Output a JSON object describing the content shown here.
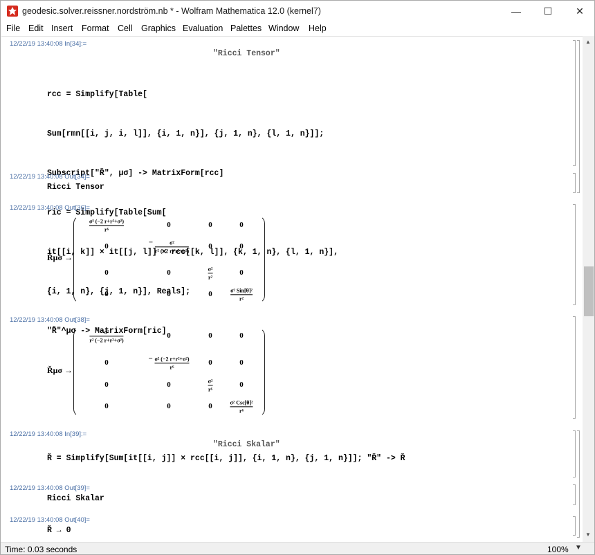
{
  "window": {
    "title": "geodesic.solver.reissner.nordström.nb * - Wolfram Mathematica 12.0 (kernel7)",
    "minimize": "—",
    "maximize": "☐",
    "close": "✕"
  },
  "menu": [
    "File",
    "Edit",
    "Insert",
    "Format",
    "Cell",
    "Graphics",
    "Evaluation",
    "Palettes",
    "Window",
    "Help"
  ],
  "cells": {
    "in34": {
      "stamp": "12/22/19 13:40:08 In[34]:=",
      "title": "\"Ricci Tensor\"",
      "lines": [
        "rcc = Simplify[Table[",
        "Sum[rmn[[i, j, i, l]], {i, 1, n}], {j, 1, n}, {l, 1, n}]];",
        "Subscript[\"Ř\", μσ] -> MatrixForm[rcc]",
        "ric = Simplify[Table[Sum[",
        "it[[i, k]] × it[[j, l]] × rcc[[k, l]], {k, 1, n}, {l, 1, n}],",
        "{i, 1, n}, {j, 1, n}], Reals];",
        "\"Ř\"^μσ -> MatrixForm[ric]"
      ]
    },
    "out34": {
      "stamp": "12/22/19 13:40:08 Out[34]=",
      "text": "Ricci Tensor"
    },
    "out36": {
      "stamp": "12/22/19 13:40:08 Out[36]=",
      "label": "Řμσ →",
      "zero": "0",
      "m00_num": "σ² (−2 r+r²+σ²)",
      "m00_den": "r⁶",
      "m11_neg": "−",
      "m11_num": "σ²",
      "m11_den": "r² (−2 r+r²+σ²)",
      "m22_num": "σ²",
      "m22_den": "r²",
      "m33_num": "σ² Sin[θ]²",
      "m33_den": "r²"
    },
    "out38": {
      "stamp": "12/22/19 13:40:08 Out[38]=",
      "label": "Řμσ →",
      "zero": "0",
      "m00_num": "σ²",
      "m00_den": "r² (−2 r+r²+σ²)",
      "m11_neg": "−",
      "m11_num": "σ² (−2 r+r²+σ²)",
      "m11_den": "r⁶",
      "m22_num": "σ²",
      "m22_den": "r⁶",
      "m33_num": "σ² Csc[θ]²",
      "m33_den": "r⁶"
    },
    "in39": {
      "stamp": "12/22/19 13:40:08 In[39]:=",
      "title": "\"Ricci Skalar\"",
      "line": "Ř = Simplify[Sum[it[[i, j]] × rcc[[i, j]], {i, 1, n}, {j, 1, n}]]; \"Ř\" -> Ř"
    },
    "out39": {
      "stamp": "12/22/19 13:40:08 Out[39]=",
      "text": "Ricci Skalar"
    },
    "out40": {
      "stamp": "12/22/19 13:40:08 Out[40]=",
      "text": "Ř → 0"
    }
  },
  "status": {
    "text": "Time: 0.03 seconds",
    "zoom": "100%"
  }
}
